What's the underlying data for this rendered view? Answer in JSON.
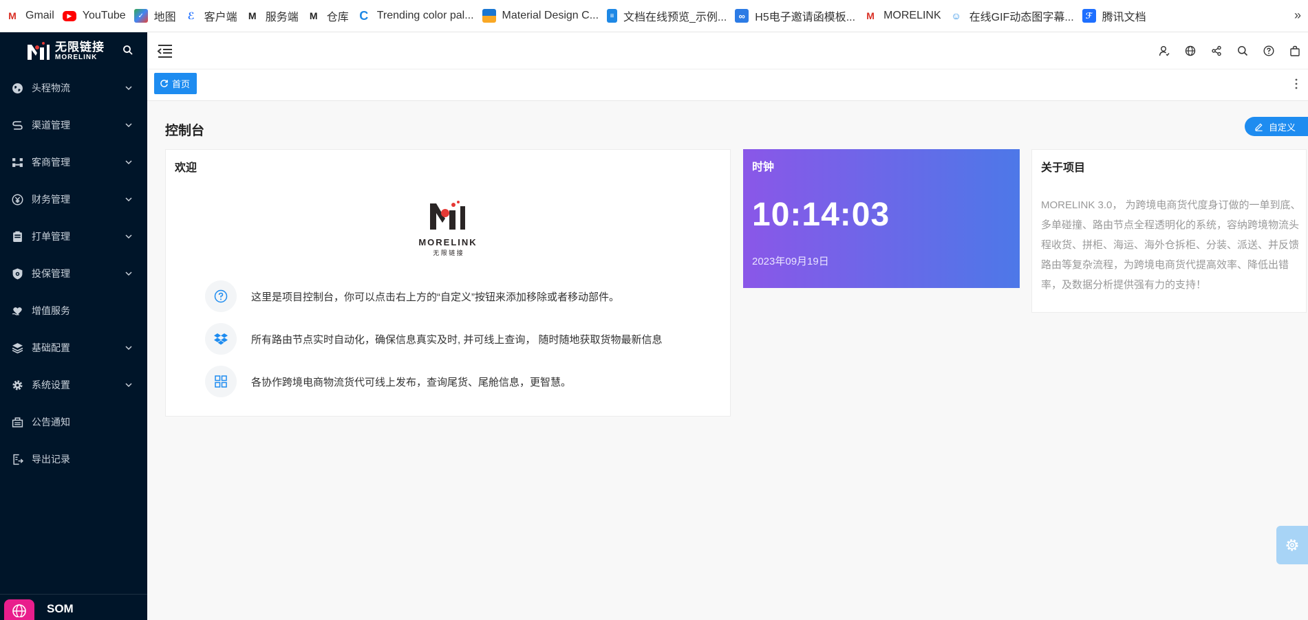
{
  "bookmarks": [
    {
      "label": "Gmail",
      "icon": "gmail-icon",
      "color": "#d93025"
    },
    {
      "label": "YouTube",
      "icon": "youtube-icon",
      "color": "#ff0000"
    },
    {
      "label": "地图",
      "icon": "maps-icon",
      "color": "#4285f4"
    },
    {
      "label": "客户端",
      "icon": "client-icon",
      "color": "#f4a300"
    },
    {
      "label": "服务端",
      "icon": "morelink-icon",
      "color": "#222222"
    },
    {
      "label": "仓库",
      "icon": "morelink-icon",
      "color": "#222222"
    },
    {
      "label": "Trending color pal...",
      "icon": "coolors-icon",
      "color": "#1e88e5"
    },
    {
      "label": "Material Design C...",
      "icon": "material-icon",
      "color": "#1976d2"
    },
    {
      "label": "文档在线预览_示例...",
      "icon": "document-icon",
      "color": "#1e88e5"
    },
    {
      "label": "H5电子邀请函模板...",
      "icon": "infinity-icon",
      "color": "#2c7be5"
    },
    {
      "label": "MORELINK",
      "icon": "gmail-icon",
      "color": "#d93025"
    },
    {
      "label": "在线GIF动态图字幕...",
      "icon": "gif-icon",
      "color": "#f5a623"
    },
    {
      "label": "腾讯文档",
      "icon": "tencent-docs-icon",
      "color": "#1e6fff"
    }
  ],
  "bookmarks_more": "»",
  "sidebar": {
    "logo_cn": "无限链接",
    "logo_en": "MORELINK",
    "items": [
      {
        "label": "头程物流",
        "icon": "globe-icon",
        "has_children": true
      },
      {
        "label": "渠道管理",
        "icon": "route-icon",
        "has_children": true
      },
      {
        "label": "客商管理",
        "icon": "users-icon",
        "has_children": true
      },
      {
        "label": "财务管理",
        "icon": "yen-icon",
        "has_children": true
      },
      {
        "label": "打单管理",
        "icon": "print-icon",
        "has_children": true
      },
      {
        "label": "投保管理",
        "icon": "shield-icon",
        "has_children": true
      },
      {
        "label": "增值服务",
        "icon": "heart-hand-icon",
        "has_children": false
      },
      {
        "label": "基础配置",
        "icon": "layers-icon",
        "has_children": true
      },
      {
        "label": "系统设置",
        "icon": "gear-icon",
        "has_children": true
      },
      {
        "label": "公告通知",
        "icon": "notice-icon",
        "has_children": false
      },
      {
        "label": "导出记录",
        "icon": "export-icon",
        "has_children": false
      }
    ],
    "footer_label": "SOM"
  },
  "header": {
    "icons": [
      "user-icon",
      "globe-icon",
      "share-icon",
      "search-icon",
      "help-icon",
      "bag-icon"
    ]
  },
  "tabs": [
    {
      "label": "首页",
      "active": true
    }
  ],
  "main": {
    "page_title": "控制台",
    "customize_label": "自定义",
    "welcome": {
      "title": "欢迎",
      "logo_en": "MORELINK",
      "logo_cn": "无 限 链 接",
      "rows": [
        {
          "icon": "help-icon",
          "text": "这里是项目控制台，你可以点击右上方的“自定义”按钮来添加移除或者移动部件。"
        },
        {
          "icon": "dropbox-icon",
          "text": "所有路由节点实时自动化，确保信息真实及时, 并可线上查询， 随时随地获取货物最新信息"
        },
        {
          "icon": "grid-icon",
          "text": "各协作跨境电商物流货代可线上发布，查询尾货、尾舱信息，更智慧。"
        }
      ]
    },
    "clock": {
      "title": "时钟",
      "time": "10:14:03",
      "date": "2023年09月19日"
    },
    "about": {
      "title": "关于项目",
      "text": "MORELINK 3.0， 为跨境电商货代度身订做的一单到底、多单碰撞、路由节点全程透明化的系统，容纳跨境物流头程收货、拼柜、海运、海外仓拆柜、分装、派送、并反馈路由等复杂流程，为跨境电商货代提高效率、降低出错率，及数据分析提供强有力的支持！"
    }
  },
  "colors": {
    "sidebar_bg": "#001529",
    "accent": "#1e8cf0",
    "clock_gradient_start": "#8a57e8",
    "clock_gradient_end": "#4d78e8"
  }
}
